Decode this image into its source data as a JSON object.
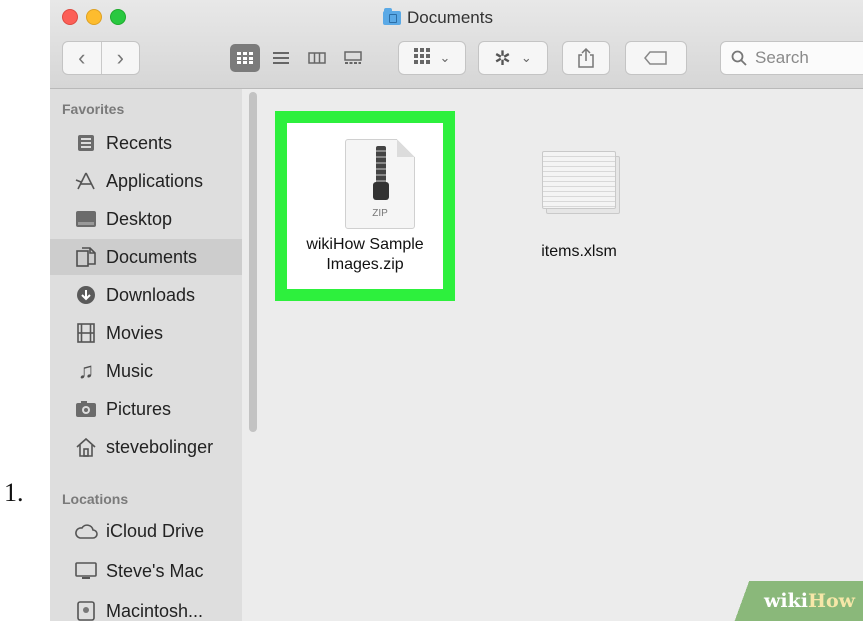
{
  "step": {
    "number": "1."
  },
  "window": {
    "title": "Documents",
    "traffic_lights": {
      "close": "#fc5f57",
      "minimize": "#fdbc2e",
      "zoom": "#29c840"
    }
  },
  "toolbar": {
    "back_icon": "chevron-left-icon",
    "forward_icon": "chevron-right-icon",
    "views": [
      "icon-view-icon",
      "list-view-icon",
      "column-view-icon",
      "gallery-view-icon"
    ],
    "active_view": "icon-view-icon",
    "search": {
      "placeholder": "Search"
    }
  },
  "sidebar": {
    "favorites_header": "Favorites",
    "favorites": [
      {
        "label": "Recents",
        "icon": "recents-icon"
      },
      {
        "label": "Applications",
        "icon": "applications-icon"
      },
      {
        "label": "Desktop",
        "icon": "desktop-icon"
      },
      {
        "label": "Documents",
        "icon": "documents-icon",
        "selected": true
      },
      {
        "label": "Downloads",
        "icon": "downloads-icon"
      },
      {
        "label": "Movies",
        "icon": "movies-icon"
      },
      {
        "label": "Music",
        "icon": "music-icon"
      },
      {
        "label": "Pictures",
        "icon": "pictures-icon"
      },
      {
        "label": "stevebolinger",
        "icon": "home-icon"
      }
    ],
    "locations_header": "Locations",
    "locations": [
      {
        "label": "iCloud Drive",
        "icon": "cloud-icon"
      },
      {
        "label": "Steve's Mac",
        "icon": "computer-icon"
      },
      {
        "label": "Macintosh...",
        "icon": "disk-icon"
      }
    ]
  },
  "files": [
    {
      "name": "wikiHow Sample Images.zip",
      "icon": "zip-file-icon",
      "icon_text": "ZIP",
      "highlight_color": "#2df03d"
    },
    {
      "name": "items.xlsm",
      "icon": "spreadsheet-file-icon"
    }
  ],
  "watermark": {
    "part1": "wiki",
    "part2": "How"
  }
}
